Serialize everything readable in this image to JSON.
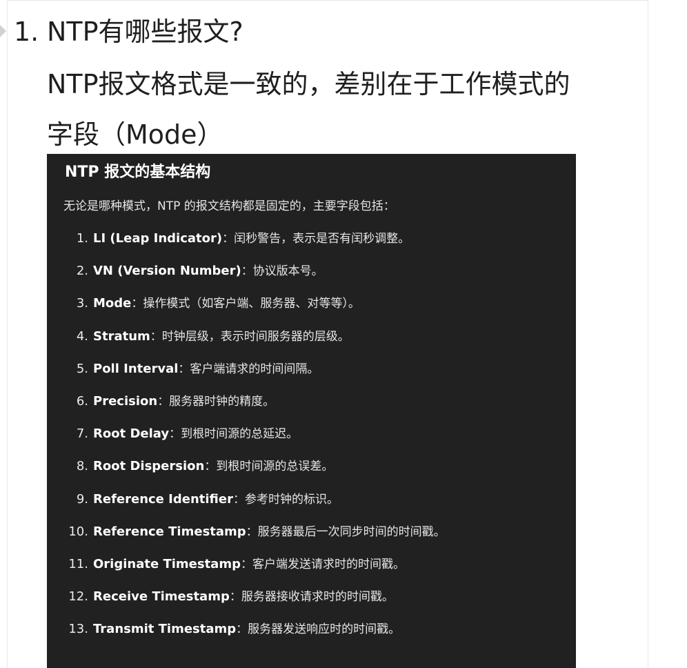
{
  "question": {
    "number": "1.",
    "title": "NTP有哪些报文?",
    "answer_line1": "NTP报文格式是一致的，差别在于工作模式的",
    "answer_line2": "字段（Mode）"
  },
  "panel": {
    "heading": "NTP 报文的基本结构",
    "intro": "无论是哪种模式，NTP 的报文结构都是固定的，主要字段包括：",
    "fields": [
      {
        "num": "1.",
        "name": "LI (Leap Indicator)",
        "desc": "：闰秒警告，表示是否有闰秒调整。"
      },
      {
        "num": "2.",
        "name": "VN (Version Number)",
        "desc": "：协议版本号。"
      },
      {
        "num": "3.",
        "name": "Mode",
        "desc": "：操作模式（如客户端、服务器、对等等）。"
      },
      {
        "num": "4.",
        "name": "Stratum",
        "desc": "：时钟层级，表示时间服务器的层级。"
      },
      {
        "num": "5.",
        "name": "Poll Interval",
        "desc": "：客户端请求的时间间隔。"
      },
      {
        "num": "6.",
        "name": "Precision",
        "desc": "：服务器时钟的精度。"
      },
      {
        "num": "7.",
        "name": "Root Delay",
        "desc": "：到根时间源的总延迟。"
      },
      {
        "num": "8.",
        "name": "Root Dispersion",
        "desc": "：到根时间源的总误差。"
      },
      {
        "num": "9.",
        "name": "Reference Identifier",
        "desc": "：参考时钟的标识。"
      },
      {
        "num": "10.",
        "name": "Reference Timestamp",
        "desc": "：服务器最后一次同步时间的时间戳。"
      },
      {
        "num": "11.",
        "name": "Originate Timestamp",
        "desc": "：客户端发送请求时的时间戳。"
      },
      {
        "num": "12.",
        "name": "Receive Timestamp",
        "desc": "：服务器接收请求时的时间戳。"
      },
      {
        "num": "13.",
        "name": "Transmit Timestamp",
        "desc": "：服务器发送响应时的时间戳。"
      }
    ]
  }
}
